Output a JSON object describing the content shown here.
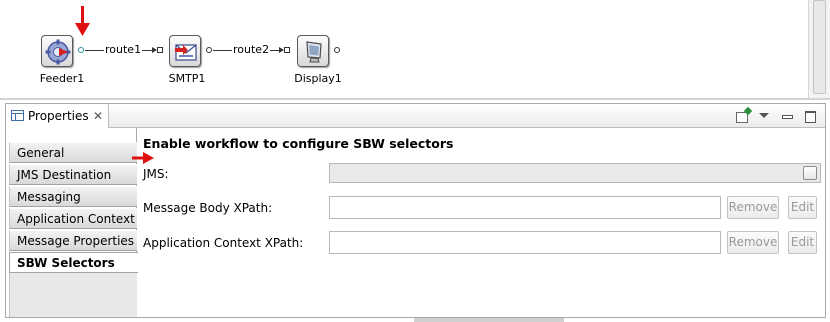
{
  "diagram": {
    "nodes": [
      {
        "name": "Feeder1",
        "icon": "gear-feeder-icon"
      },
      {
        "name": "SMTP1",
        "icon": "email-icon"
      },
      {
        "name": "Display1",
        "icon": "monitor-icon"
      }
    ],
    "connections": [
      {
        "label": "route1"
      },
      {
        "label": "route2"
      }
    ]
  },
  "properties_view": {
    "tab_title": "Properties",
    "close_glyph": "✕",
    "categories": [
      "General",
      "JMS Destination",
      "Messaging",
      "Application Context",
      "Message Properties",
      "SBW Selectors"
    ],
    "selected_category": "SBW Selectors",
    "form": {
      "heading": "Enable workflow to configure SBW selectors",
      "jms_label": "JMS:",
      "message_body_xpath_label": "Message Body XPath:",
      "message_body_xpath_value": "",
      "app_context_xpath_label": "Application Context XPath:",
      "app_context_xpath_value": "",
      "remove_label": "Remove",
      "edit_label": "Edit"
    }
  },
  "colors": {
    "annotation_arrow": "#e01010",
    "disabled_text": "#9a9a9a"
  }
}
